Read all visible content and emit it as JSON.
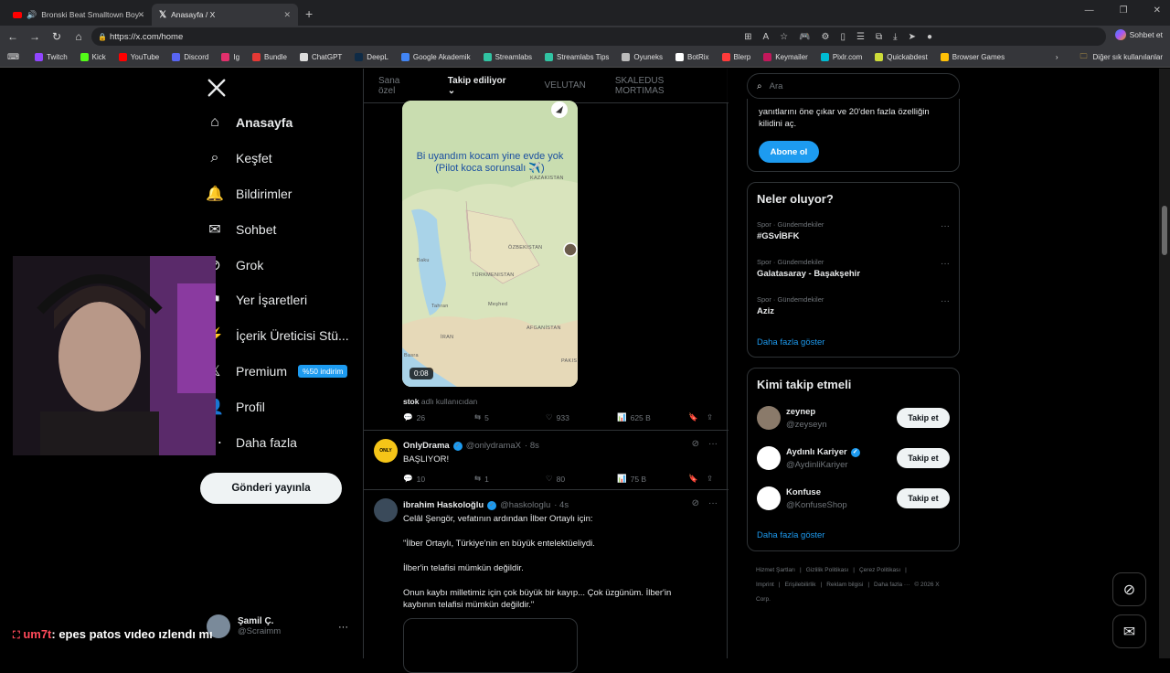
{
  "browser": {
    "tabs": [
      {
        "title": "Bronski Beat Smalltown Boy -",
        "active": false
      },
      {
        "title": "Anasayfa / X",
        "active": true
      }
    ],
    "url": "https://x.com/home",
    "sohbet": "Sohbet et",
    "bookmarks": [
      {
        "label": "Twitch",
        "color": "#9146ff"
      },
      {
        "label": "Kick",
        "color": "#53fc18"
      },
      {
        "label": "YouTube",
        "color": "#ff0000"
      },
      {
        "label": "Discord",
        "color": "#5865f2"
      },
      {
        "label": "Ig",
        "color": "#e1306c"
      },
      {
        "label": "Bundle",
        "color": "#e53935"
      },
      {
        "label": "ChatGPT",
        "color": "#dddddd"
      },
      {
        "label": "DeepL",
        "color": "#0f2b46"
      },
      {
        "label": "Google Akademik",
        "color": "#4285f4"
      },
      {
        "label": "Streamlabs",
        "color": "#31c3a2"
      },
      {
        "label": "Streamlabs Tips",
        "color": "#31c3a2"
      },
      {
        "label": "Oyuneks",
        "color": "#bbbbbb"
      },
      {
        "label": "BotRix",
        "color": "#ffffff"
      },
      {
        "label": "Blerp",
        "color": "#ff3b3b"
      },
      {
        "label": "Keymailer",
        "color": "#c2185b"
      },
      {
        "label": "Pixlr.com",
        "color": "#00bcd4"
      },
      {
        "label": "Quickabdest",
        "color": "#cddc39"
      },
      {
        "label": "Browser Games",
        "color": "#ffc107"
      }
    ],
    "other_bookmarks": "Diğer sık kullanılanlar"
  },
  "nav": {
    "items": [
      {
        "label": "Anasayfa",
        "icon": "home-icon"
      },
      {
        "label": "Keşfet",
        "icon": "search-icon"
      },
      {
        "label": "Bildirimler",
        "icon": "bell-icon"
      },
      {
        "label": "Sohbet",
        "icon": "mail-icon"
      },
      {
        "label": "Grok",
        "icon": "grok-icon"
      },
      {
        "label": "Yer İşaretleri",
        "icon": "bookmark-icon"
      },
      {
        "label": "İçerik Üreticisi Stü...",
        "icon": "creator-icon"
      },
      {
        "label": "Premium",
        "icon": "premium-icon"
      },
      {
        "label": "Profil",
        "icon": "person-icon"
      },
      {
        "label": "Daha fazla",
        "icon": "more-icon"
      }
    ],
    "premium_badge": "%50 indirim",
    "post_button": "Gönderi yayınla",
    "user": {
      "name": "Şamil Ç.",
      "handle": "@Scraimm"
    }
  },
  "stream_overlay": {
    "chat_user": "um7t",
    "chat_message": ": epes patos vıdeo ızlendı mı"
  },
  "timeline": {
    "tabs": [
      "Sana özel",
      "Takip ediliyor",
      "VELUTAN",
      "SKALEDUS MORTIMAS"
    ],
    "video": {
      "caption": "Bi uyandım kocam yine evde yok (Pilot koca sorunsalı ✈️)",
      "duration": "0:08",
      "map_labels": [
        "KAZAKISTAN",
        "ÖZBEKISTAN",
        "Baku",
        "TÜRKMENISTAN",
        "Tahran",
        "Meşhed",
        "İRAN",
        "AFGANİSTAN",
        "Basra",
        "PAKIS"
      ],
      "source_user": "stok",
      "source_suffix": "adlı kullanıcıdan",
      "replies": "26",
      "reposts": "5",
      "likes": "933",
      "views": "625 B"
    },
    "posts": [
      {
        "name": "OnlyDrama",
        "handle": "@onlydramaX",
        "time": "· 8s",
        "text": "BAŞLIYOR!",
        "replies": "10",
        "reposts": "1",
        "likes": "80",
        "views": "75 B"
      },
      {
        "name": "ibrahim Haskoloğlu",
        "handle": "@haskologlu",
        "time": "· 4s",
        "lines": [
          "Celâl Şengör, vefatının ardından İlber Ortaylı için:",
          "\"İlber Ortaylı, Türkiye'nin en büyük entelektüeliydi.",
          "İlber'in telafisi mümkün değildir.",
          "Onun kaybı milletimiz için çok büyük bir kayıp... Çok üzgünüm. İlber'in kaybının telafisi mümkün değildir.\""
        ]
      }
    ]
  },
  "sidebar": {
    "search_placeholder": "Ara",
    "premium_text": "yanıtlarını öne çıkar ve 20'den fazla özelliğin kilidini aç.",
    "subscribe": "Abone ol",
    "trends_title": "Neler oluyor?",
    "trends": [
      {
        "meta": "Spor · Gündemdekiler",
        "name": "#GSvİBFK"
      },
      {
        "meta": "Spor · Gündemdekiler",
        "name": "Galatasaray - Başakşehir"
      },
      {
        "meta": "Spor · Gündemdekiler",
        "name": "Aziz"
      }
    ],
    "show_more": "Daha fazla göster",
    "who_title": "Kimi takip etmeli",
    "who": [
      {
        "name": "zeynep",
        "handle": "@zeyseyn",
        "verified": false
      },
      {
        "name": "Aydınlı Kariyer",
        "handle": "@AydinliKariyer",
        "verified": true
      },
      {
        "name": "Konfuse",
        "handle": "@KonfuseShop",
        "verified": false
      }
    ],
    "follow": "Takip et",
    "footer": [
      "Hizmet Şartları",
      "|",
      "Gizlilik Politikası",
      "|",
      "Çerez Politikası",
      "|",
      "Imprint",
      "|",
      "Erişilebilirlik",
      "|",
      "Reklam bilgisi",
      "|",
      "Daha fazla ···",
      "© 2026 X Corp."
    ]
  }
}
